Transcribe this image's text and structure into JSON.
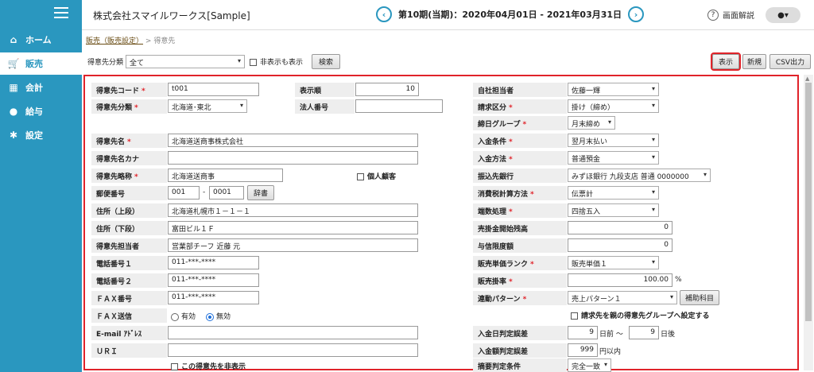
{
  "nav": {
    "items": [
      {
        "label": "ホーム",
        "icon": "home-icon"
      },
      {
        "label": "販売",
        "icon": "cart-icon"
      },
      {
        "label": "会計",
        "icon": "calculator-icon"
      },
      {
        "label": "給与",
        "icon": "money-bag-icon"
      },
      {
        "label": "設定",
        "icon": "gear-icon"
      }
    ]
  },
  "header": {
    "company": "株式会社スマイルワークス[Sample]",
    "period": "第10期(当期)：2020年04月01日 - 2021年03月31日",
    "help": "画面解説"
  },
  "breadcrumb": {
    "link": "販売（販売設定）",
    "separator": ">",
    "current": "得意先"
  },
  "filter": {
    "category_label": "得意先分類",
    "category_value": "全て",
    "show_hidden_label": "非表示も表示",
    "search_button": "検索",
    "display_button": "表示",
    "new_button": "新規",
    "csv_button": "CSV出力"
  },
  "form": {
    "left": {
      "code_label": "得意先コード",
      "code_value": "t001",
      "category_label": "得意先分類",
      "category_value": "北海道･東北",
      "name_label": "得意先名",
      "name_value": "北海道送商事株式会社",
      "kana_label": "得意先名カナ",
      "kana_value": "",
      "short_label": "得意先略称",
      "short_value": "北海道送商事",
      "individual_label": "個人顧客",
      "postal_label": "郵便番号",
      "postal1": "001",
      "postal_sep": "-",
      "postal2": "0001",
      "dictionary_button": "辞書",
      "address1_label": "住所（上段）",
      "address1_value": "北海道札幌市１－１－１",
      "address2_label": "住所（下段）",
      "address2_value": "富田ビル１Ｆ",
      "contact_label": "得意先担当者",
      "contact_value": "営業部チーフ 近藤 元",
      "phone1_label": "電話番号１",
      "phone1_value": "011-***-****",
      "phone2_label": "電話番号２",
      "phone2_value": "011-***-****",
      "fax_label": "ＦＡＸ番号",
      "fax_value": "011-***-****",
      "fax_send_label": "ＦＡＸ送信",
      "fax_on": "有効",
      "fax_off": "無効",
      "email_label": "E-mail ｱﾄﾞﾚｽ",
      "email_value": "",
      "uri_label": "ＵＲＩ",
      "uri_value": "",
      "hide_label": "この得意先を非表示"
    },
    "middle": {
      "order_label": "表示順",
      "order_value": "10",
      "corp_label": "法人番号",
      "corp_value": ""
    },
    "right": {
      "staff_label": "自社担当者",
      "staff_value": "佐藤一輝",
      "billing_label": "請求区分",
      "billing_value": "掛け（締め）",
      "closing_label": "締日グループ",
      "closing_value": "月末締め",
      "payment_terms_label": "入金条件",
      "payment_terms_value": "翌月末払い",
      "payment_method_label": "入金方法",
      "payment_method_value": "普通預金",
      "bank_label": "振込先銀行",
      "bank_value": "みずほ銀行 九段支店 普通 0000000",
      "tax_calc_label": "消費税計算方法",
      "tax_calc_value": "伝票計",
      "rounding_label": "端数処理",
      "rounding_value": "四捨五入",
      "ar_balance_label": "売掛金開始残高",
      "ar_balance_value": "0",
      "credit_label": "与信限度額",
      "credit_value": "0",
      "price_rank_label": "販売単価ランク",
      "price_rank_value": "販売単価１",
      "rate_label": "販売掛率",
      "rate_value": "100.00",
      "rate_unit": "%",
      "link_pattern_label": "連動パターン",
      "link_pattern_value": "売上パターン１",
      "aux_button": "補助科目",
      "parent_group_label": "請求先を親の得意先グループへ設定する",
      "date_tol_label": "入金日判定誤差",
      "date_before": "9",
      "date_before_unit": "日前 〜",
      "date_after": "9",
      "date_after_unit": "日後",
      "amount_tol_label": "入金額判定誤差",
      "amount_tol_value": "999",
      "amount_tol_unit": "円以内",
      "summary_label": "摘要判定条件",
      "summary_value": "完全一致"
    }
  }
}
